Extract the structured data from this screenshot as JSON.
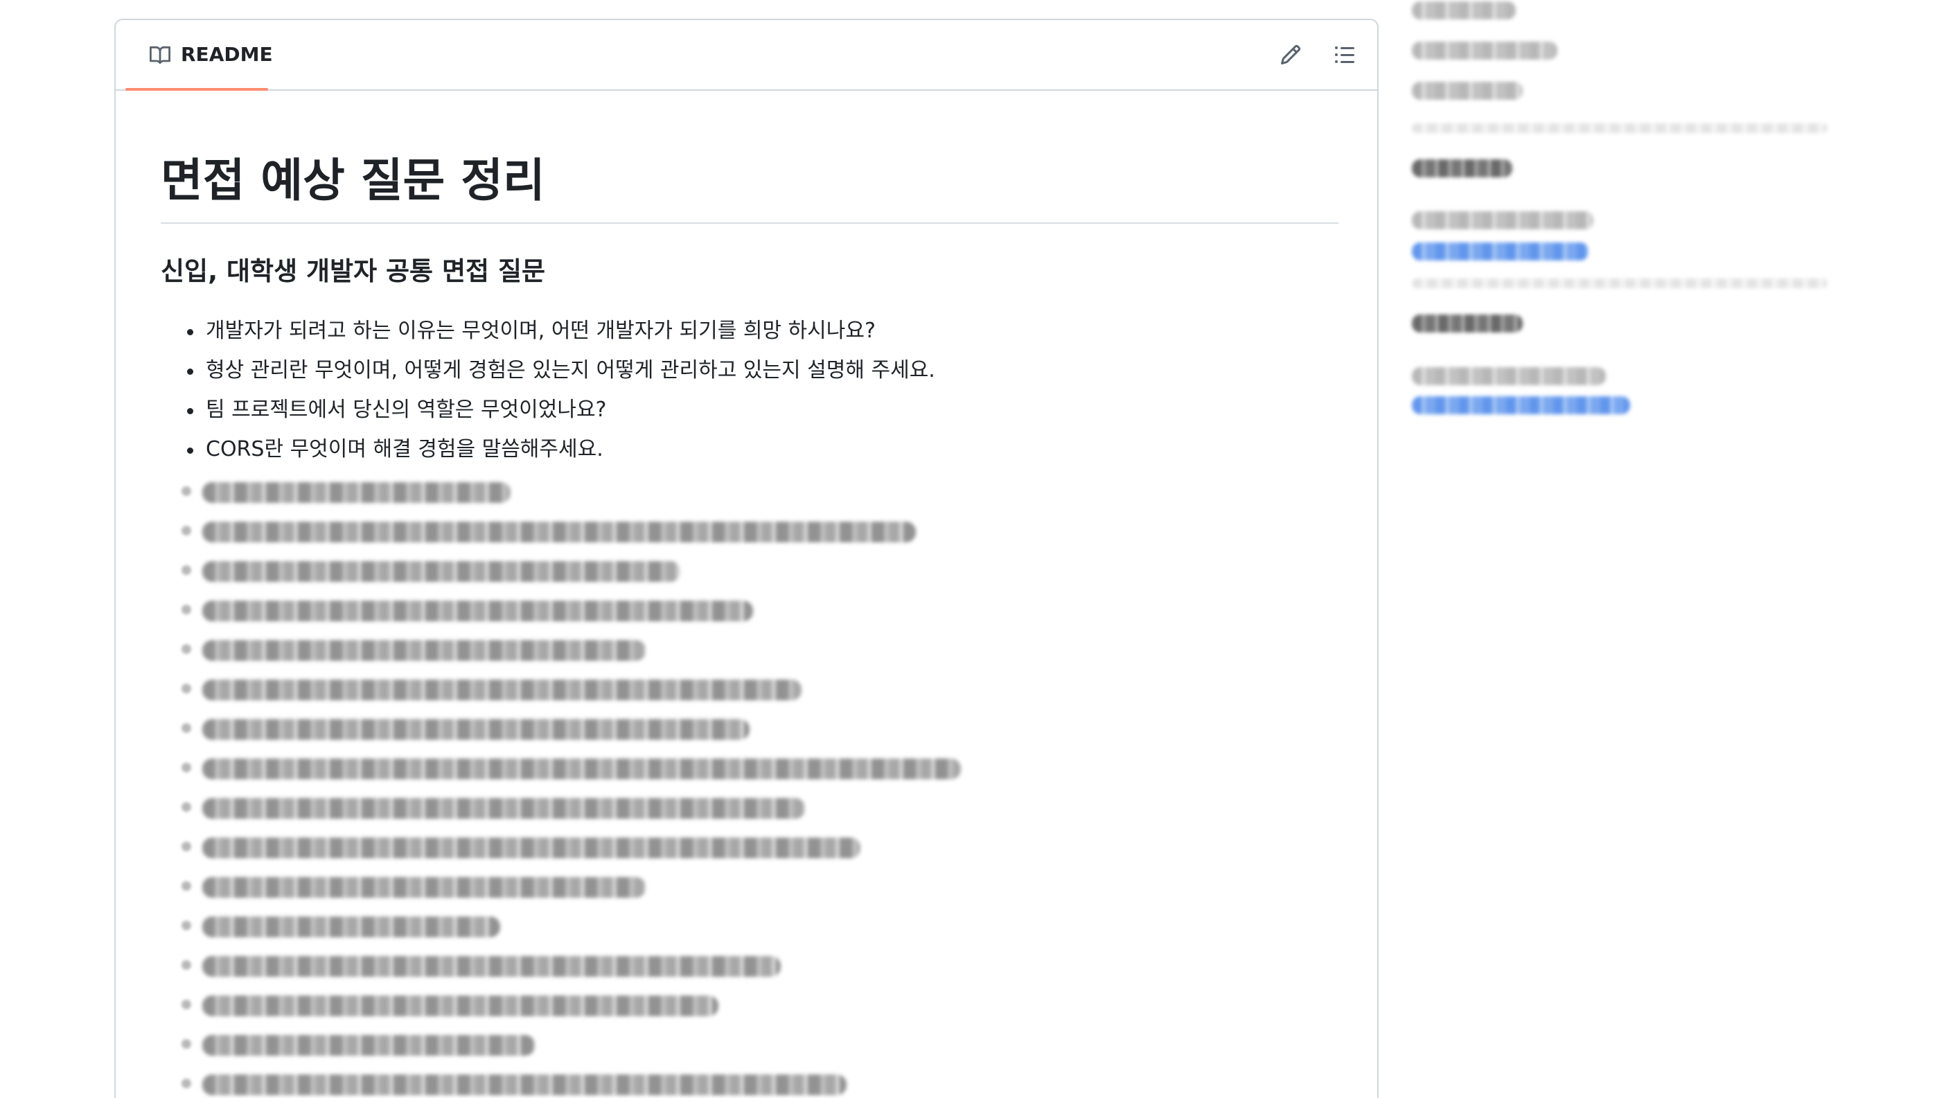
{
  "readme": {
    "tab_label": "README",
    "edit_icon": "pencil-icon",
    "toc_icon": "list-unordered-icon"
  },
  "content": {
    "title": "면접 예상 질문 정리",
    "section_heading": "신입, 대학생 개발자 공통 면접 질문",
    "questions": [
      "개발자가 되려고 하는 이유는 무엇이며, 어떤 개발자가 되기를 희망 하시나요?",
      "형상 관리란 무엇이며, 어떻게 경험은 있는지 어떻게 관리하고 있는지 설명해 주세요.",
      "팀 프로젝트에서 당신의 역할은 무엇이었나요?",
      "CORS란 무엇이며 해결 경험을 말씀해주세요."
    ]
  },
  "colors": {
    "tab_underline": "#fd8c73",
    "border": "#d0d7de",
    "text": "#1f2328",
    "link": "#3b7de8"
  }
}
